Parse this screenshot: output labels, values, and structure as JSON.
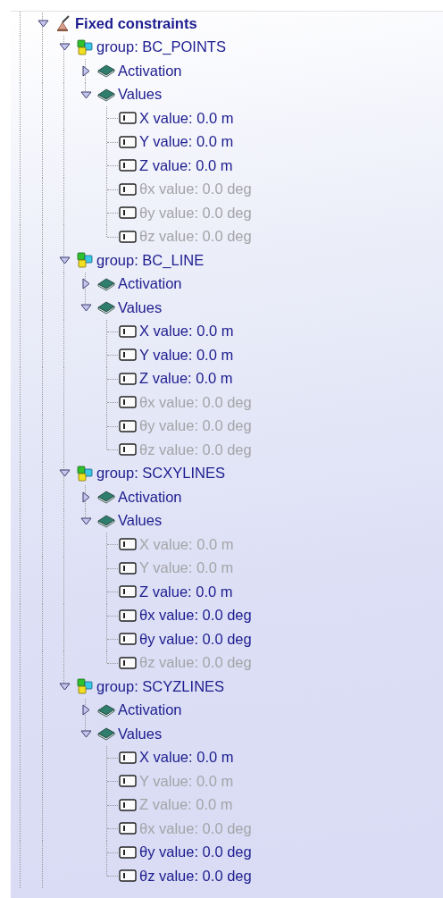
{
  "tree": [
    {
      "kind": "constraint",
      "label": "Fixed constraints",
      "expanded": true,
      "children": [
        {
          "kind": "group",
          "label": "group: BC_POINTS",
          "expanded": true,
          "children": [
            {
              "kind": "book",
              "label": "Activation",
              "expanded": false
            },
            {
              "kind": "book",
              "label": "Values",
              "expanded": true,
              "children": [
                {
                  "kind": "value",
                  "label": "X value: 0.0 m",
                  "enabled": true
                },
                {
                  "kind": "value",
                  "label": "Y value: 0.0 m",
                  "enabled": true
                },
                {
                  "kind": "value",
                  "label": "Z value: 0.0 m",
                  "enabled": true
                },
                {
                  "kind": "value",
                  "label": "θx value: 0.0 deg",
                  "enabled": false
                },
                {
                  "kind": "value",
                  "label": "θy value: 0.0 deg",
                  "enabled": false
                },
                {
                  "kind": "value",
                  "label": "θz value: 0.0 deg",
                  "enabled": false
                }
              ]
            }
          ]
        },
        {
          "kind": "group",
          "label": "group: BC_LINE",
          "expanded": true,
          "children": [
            {
              "kind": "book",
              "label": "Activation",
              "expanded": false
            },
            {
              "kind": "book",
              "label": "Values",
              "expanded": true,
              "children": [
                {
                  "kind": "value",
                  "label": "X value: 0.0 m",
                  "enabled": true
                },
                {
                  "kind": "value",
                  "label": "Y value: 0.0 m",
                  "enabled": true
                },
                {
                  "kind": "value",
                  "label": "Z value: 0.0 m",
                  "enabled": true
                },
                {
                  "kind": "value",
                  "label": "θx value: 0.0 deg",
                  "enabled": false
                },
                {
                  "kind": "value",
                  "label": "θy value: 0.0 deg",
                  "enabled": false
                },
                {
                  "kind": "value",
                  "label": "θz value: 0.0 deg",
                  "enabled": false
                }
              ]
            }
          ]
        },
        {
          "kind": "group",
          "label": "group: SCXYLINES",
          "expanded": true,
          "children": [
            {
              "kind": "book",
              "label": "Activation",
              "expanded": false
            },
            {
              "kind": "book",
              "label": "Values",
              "expanded": true,
              "children": [
                {
                  "kind": "value",
                  "label": "X value: 0.0 m",
                  "enabled": false
                },
                {
                  "kind": "value",
                  "label": "Y value: 0.0 m",
                  "enabled": false
                },
                {
                  "kind": "value",
                  "label": "Z value: 0.0 m",
                  "enabled": true
                },
                {
                  "kind": "value",
                  "label": "θx value: 0.0 deg",
                  "enabled": true
                },
                {
                  "kind": "value",
                  "label": "θy value: 0.0 deg",
                  "enabled": true
                },
                {
                  "kind": "value",
                  "label": "θz value: 0.0 deg",
                  "enabled": false
                }
              ]
            }
          ]
        },
        {
          "kind": "group",
          "label": "group: SCYZLINES",
          "expanded": true,
          "children": [
            {
              "kind": "book",
              "label": "Activation",
              "expanded": false
            },
            {
              "kind": "book",
              "label": "Values",
              "expanded": true,
              "children": [
                {
                  "kind": "value",
                  "label": "X value: 0.0 m",
                  "enabled": true
                },
                {
                  "kind": "value",
                  "label": "Y value: 0.0 m",
                  "enabled": false
                },
                {
                  "kind": "value",
                  "label": "Z value: 0.0 m",
                  "enabled": false
                },
                {
                  "kind": "value",
                  "label": "θx value: 0.0 deg",
                  "enabled": false
                },
                {
                  "kind": "value",
                  "label": "θy value: 0.0 deg",
                  "enabled": true
                },
                {
                  "kind": "value",
                  "label": "θz value: 0.0 deg",
                  "enabled": true
                }
              ]
            }
          ]
        }
      ]
    }
  ]
}
